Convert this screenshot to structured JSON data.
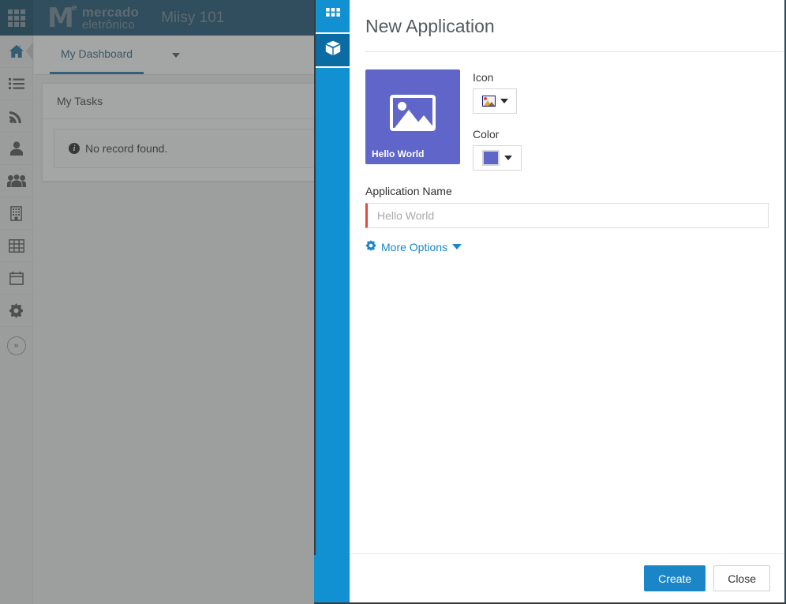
{
  "topbar": {
    "grid_icon": "grid-apps-icon",
    "brand_mark": "M",
    "brand_sup": "e",
    "brand_word1": "mercado",
    "brand_word2": "eletrônico",
    "app_title": "Miisy 101"
  },
  "sidebar": {
    "items": [
      {
        "icon": "home-icon",
        "name": "home",
        "active": true
      },
      {
        "icon": "list-icon",
        "name": "list",
        "active": false
      },
      {
        "icon": "rss-icon",
        "name": "feed",
        "active": false
      },
      {
        "icon": "user-icon",
        "name": "user",
        "active": false
      },
      {
        "icon": "users-icon",
        "name": "groups",
        "active": false
      },
      {
        "icon": "building-icon",
        "name": "company",
        "active": false
      },
      {
        "icon": "table-icon",
        "name": "table",
        "active": false
      },
      {
        "icon": "calendar-icon",
        "name": "calendar",
        "active": false
      },
      {
        "icon": "gear-icon",
        "name": "settings",
        "active": false
      }
    ],
    "expand_icon": "double-chevron-right-icon"
  },
  "dashboard": {
    "tab_label": "My Dashboard",
    "tab_caret_icon": "caret-down-icon",
    "panel_title": "My Tasks",
    "empty_icon": "info-icon",
    "empty_text": "No record found."
  },
  "modal": {
    "title": "New Application",
    "rail": [
      {
        "icon": "grid-icon",
        "name": "applications-rail-button"
      },
      {
        "icon": "cube-icon",
        "name": "objects-rail-button"
      }
    ],
    "preview": {
      "label": "Hello World",
      "icon": "image-icon",
      "bg_color": "#6065c9"
    },
    "icon_field": {
      "label": "Icon",
      "picker_icon": "image-icon",
      "caret_icon": "caret-down-icon"
    },
    "color_field": {
      "label": "Color",
      "swatch_color": "#6065c9",
      "caret_icon": "caret-down-icon"
    },
    "name_field": {
      "label": "Application Name",
      "value": "",
      "placeholder": "Hello World",
      "required_accent": "#e04b3e"
    },
    "more_options": {
      "label": "More Options",
      "gear_icon": "gear-icon",
      "caret_icon": "chevron-down-icon"
    },
    "footer": {
      "create_label": "Create",
      "close_label": "Close"
    }
  },
  "colors": {
    "topbar": "#0d4a6b",
    "accent_blue": "#1191d1",
    "primary_button": "#1a86c8",
    "overlay": "#7d7f80"
  }
}
